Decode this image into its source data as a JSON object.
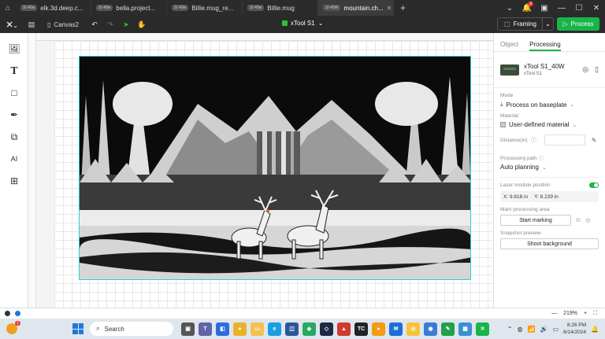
{
  "tabs": [
    {
      "pill": "SI 40w",
      "label": "elk.3d.deep.c...",
      "active": false
    },
    {
      "pill": "SI 40w",
      "label": "bella.project...",
      "active": false
    },
    {
      "pill": "SI 40w",
      "label": "Billie.mug_re...",
      "active": false
    },
    {
      "pill": "SI 40w",
      "label": "Billie.mug",
      "active": false
    },
    {
      "pill": "SI 40W",
      "label": "mountain.ch...",
      "active": true
    }
  ],
  "window": {
    "notification_count": "3"
  },
  "toolbar": {
    "canvas_name": "Canvas2",
    "device_name": "xTool S1",
    "framing_label": "Framing",
    "process_label": "Process"
  },
  "panel": {
    "tab_object": "Object",
    "tab_processing": "Processing",
    "device_model": "xTool S1_40W",
    "device_sub": "xTool S1",
    "mode_label": "Mode",
    "mode_value": "Process on baseplate",
    "material_label": "Material",
    "material_value": "User-defined material",
    "distance_label": "Distance(in)",
    "processing_path_label": "Processing path",
    "processing_path_value": "Auto planning",
    "laser_position_label": "Laser module position",
    "x_coord": "X: 9.818 in",
    "y_coord": "Y: 8.239 in",
    "mark_area_label": "Mark processing area",
    "start_marking": "Start marking",
    "snapshot_label": "Snapshot preview",
    "shoot_background": "Shoot background"
  },
  "statusbar": {
    "zoom": "219%"
  },
  "taskbar": {
    "weather_badge": "1",
    "search_placeholder": "Search",
    "time": "8:26 PM",
    "date": "6/14/2024"
  },
  "colors": {
    "accent": "#19b44a",
    "selection": "#30d0d0"
  }
}
